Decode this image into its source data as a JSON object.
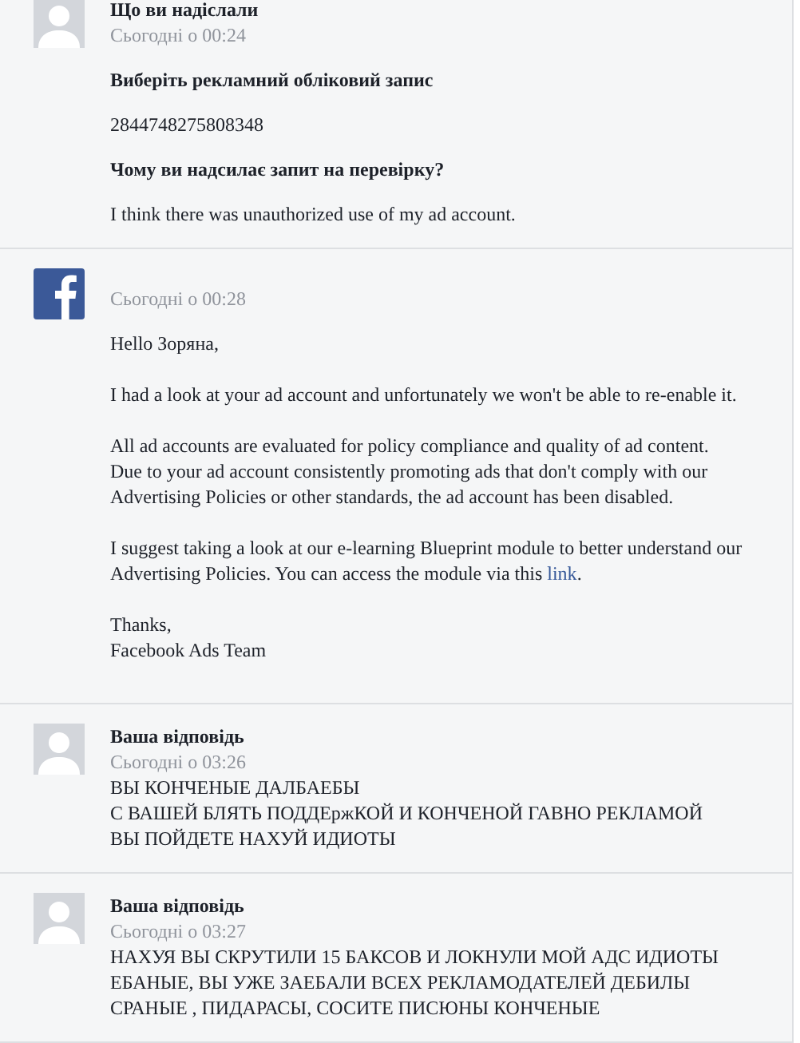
{
  "messages": [
    {
      "kind": "request",
      "avatar": {
        "kind": "user"
      },
      "author": "Що ви надіслали",
      "time": "Сьогодні о 00:24",
      "body": [
        {
          "kind": "heading",
          "text": "Виберіть рекламний обліковий запис"
        },
        {
          "kind": "text",
          "text": "2844748275808348"
        },
        {
          "kind": "heading",
          "text": "Чому ви надсилає запит на перевірку?"
        },
        {
          "kind": "text",
          "text": "I think there was unauthorized use of my ad account."
        }
      ]
    },
    {
      "kind": "support",
      "avatar": {
        "kind": "facebook"
      },
      "time": "Сьогодні о 00:28",
      "body": [
        {
          "kind": "text",
          "text": "Hello Зоряна,"
        },
        {
          "kind": "text",
          "text": "I had a look at your ad account and unfortunately we won't be able to re-enable it."
        },
        {
          "kind": "text",
          "text": "All ad accounts are evaluated for policy compliance and quality of ad content.\nDue to your ad account consistently promoting ads that don't comply with our\nAdvertising Policies or other standards, the ad account has been disabled."
        },
        {
          "kind": "text",
          "text": "I suggest taking a look at our e-learning Blueprint module to better understand our\nAdvertising Policies. You can access the module via this",
          "link": "link",
          "after": "."
        },
        {
          "kind": "text",
          "text": "Thanks,\nFacebook Ads Team"
        }
      ]
    },
    {
      "kind": "reply",
      "avatar": {
        "kind": "user"
      },
      "author": "Ваша відповідь",
      "time": "Сьогодні о 03:26",
      "body": [
        {
          "kind": "text",
          "text": "ВЫ КОНЧЕНЫЕ ДАЛБАЕБЫ\nС ВАШЕЙ БЛЯТЬ ПОДДЕржКОЙ И КОНЧЕНОЙ ГАВНО РЕКЛАМОЙ\nВЫ ПОЙДЕТЕ НАХУЙ ИДИОТЫ"
        }
      ]
    },
    {
      "kind": "reply",
      "avatar": {
        "kind": "user"
      },
      "author": "Ваша відповідь",
      "time": "Сьогодні о 03:27",
      "body": [
        {
          "kind": "text",
          "text": "НАХУЯ ВЫ СКРУТИЛИ 15 БАКСОВ И ЛОКНУЛИ МОЙ АДС ИДИОТЫ\nЕБАНЫЕ, ВЫ УЖЕ ЗАЕБАЛИ ВСЕХ РЕКЛАМОДАТЕЛЕЙ ДЕБИЛЫ\nСРАНЫЕ , ПИДАРАСЫ, СОСИТЕ ПИСЮНЫ КОНЧЕНЫЕ"
        }
      ]
    }
  ]
}
